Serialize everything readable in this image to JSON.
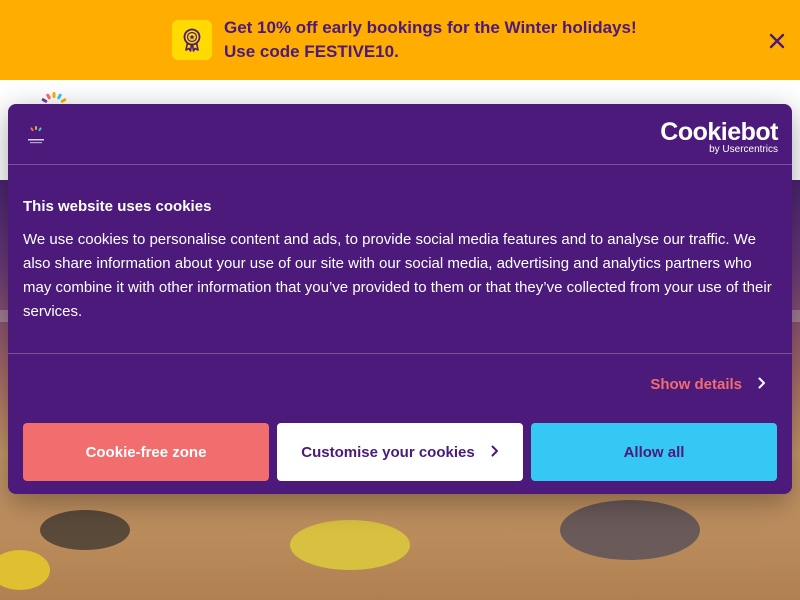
{
  "promo": {
    "line1": "Get 10% off early bookings for the Winter holidays!",
    "line2": "Use code FESTIVE10.",
    "badge_icon": "award-badge-icon",
    "close_icon": "close-icon",
    "background": "#ffad00",
    "text_color": "#4b1a7a"
  },
  "cookie_dialog": {
    "brand_name": "Cookiebot",
    "brand_sub": "by Usercentrics",
    "title": "This website uses cookies",
    "body": "We use cookies to personalise content and ads, to provide social media features and to analyse our traffic. We also share information about your use of our site with our social media, advertising and analytics partners who may combine it with other information that you’ve provided to them or that they’ve collected from your use of their services.",
    "show_details": "Show details",
    "buttons": {
      "cookie_free": "Cookie-free zone",
      "customise": "Customise your cookies",
      "allow_all": "Allow all"
    },
    "colors": {
      "background": "#4b1a7a",
      "accent_red": "#f26d6d",
      "accent_blue": "#36c8f5"
    }
  }
}
